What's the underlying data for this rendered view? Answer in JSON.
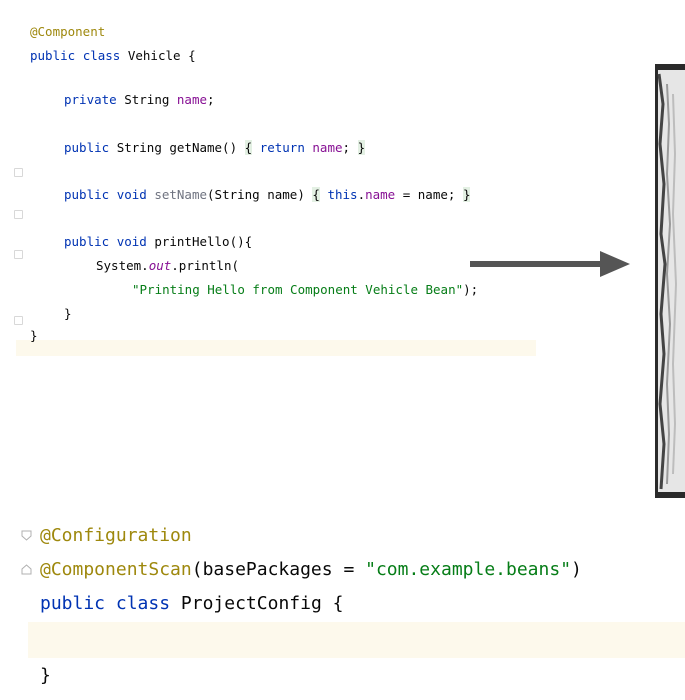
{
  "top_code": {
    "line1_annotation": "@Component",
    "line2": {
      "kw1": "public",
      "kw2": "class",
      "name": "Vehicle",
      "brace": "{"
    },
    "line3": {
      "kw": "private",
      "type": "String",
      "field": "name",
      "end": ";"
    },
    "line4": {
      "kw": "public",
      "type": "String",
      "method": "getName()",
      "open": "{",
      "ret": "return",
      "field": "name",
      "end": ";",
      "close": "}"
    },
    "line5": {
      "kw1": "public",
      "kw2": "void",
      "method": "setName",
      "params": "(String name)",
      "open": "{",
      "this": "this",
      "dot": ".",
      "field": "name",
      "assign": " = name;",
      "close": "}"
    },
    "line6": {
      "kw1": "public",
      "kw2": "void",
      "method": "printHello(){"
    },
    "line7": {
      "cls": "System.",
      "static": "out",
      "rest": ".println("
    },
    "line8": {
      "string": "\"Printing Hello from Component Vehicle Bean\"",
      "end": ");"
    },
    "line9": "}",
    "line10": "}"
  },
  "bottom_code": {
    "line1": "@Configuration",
    "line2": {
      "annotation": "@ComponentScan",
      "open": "(",
      "param": "basePackages = ",
      "string": "\"com.example.beans\"",
      "close": ")"
    },
    "line3": {
      "kw1": "public",
      "kw2": "class",
      "name": "ProjectConfig",
      "brace": "{"
    },
    "line5": "}"
  },
  "colors": {
    "annotation": "#9e880d",
    "keyword": "#0033b3",
    "field": "#871094",
    "string": "#067d17",
    "arrow": "#555555",
    "current_line": "#fdf9ec"
  }
}
